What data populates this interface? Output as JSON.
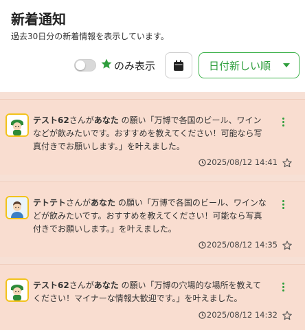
{
  "header": {
    "title": "新着通知",
    "subtitle": "過去30日分の新着情報を表示しています。",
    "filter_label": "のみ表示",
    "sort_label": "日付新しい順"
  },
  "colors": {
    "accent": "#2e9e3c",
    "card_bg": "#f9ddd0",
    "avatar_border": "#f2c21a"
  },
  "notifications": [
    {
      "user": "テスト62",
      "connector": "さんが",
      "target": "あなた",
      "body": " の願い「万博で各国のビール、ワインなどが飲みたいです。おすすめを教えてください！可能なら写真付きでお願いします。」を叶えました。",
      "datetime": "2025/08/12 14:41",
      "avatar": "green-cap-character"
    },
    {
      "user": "テトテト",
      "connector": "さんが",
      "target": "あなた",
      "body": " の願い「万博で各国のビール、ワインなどが飲みたいです。おすすめを教えてください！可能なら写真付きでお願いします。」を叶えました。",
      "datetime": "2025/08/12 14:35",
      "avatar": "man-portrait"
    },
    {
      "user": "テスト62",
      "connector": "さんが",
      "target": "あなた",
      "body": " の願い「万博の穴場的な場所を教えてください！マイナーな情報大歓迎です。」を叶えました。",
      "datetime": "2025/08/12 14:32",
      "avatar": "green-cap-character"
    }
  ]
}
